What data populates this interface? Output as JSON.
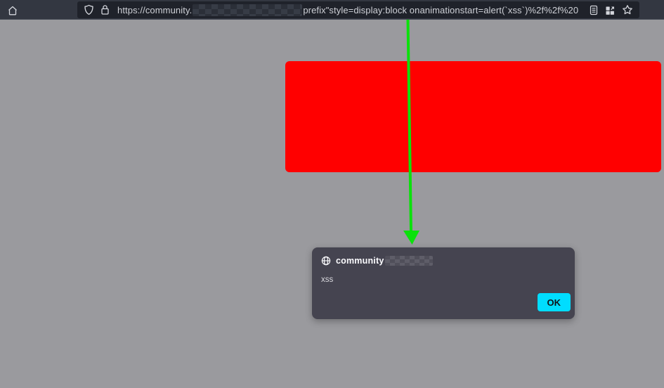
{
  "toolbar": {
    "url": {
      "prefix": "https://community.",
      "redacted_segment": "pixelated-blur",
      "suffix": "prefix\"style=display:block onanimationstart=alert(`xss`)%2f%2f%20"
    },
    "icons": {
      "left": [
        "home-icon"
      ],
      "urlbar_left": [
        "tracking-protection-shield-icon",
        "lock-icon"
      ],
      "urlbar_right": [
        "reader-view-icon",
        "grid-icon",
        "bookmark-star-icon"
      ]
    }
  },
  "page": {
    "background_color": "#9a9a9e",
    "red_box_color": "#ff0000",
    "arrow_color": "#0be10b"
  },
  "dialog": {
    "origin_icon": "globe-icon",
    "title_prefix": "community",
    "title_redacted_segment": "pixelated-blur",
    "message": "xss",
    "ok_label": "OK",
    "ok_button_color": "#00ddff",
    "background_color": "#454450"
  }
}
